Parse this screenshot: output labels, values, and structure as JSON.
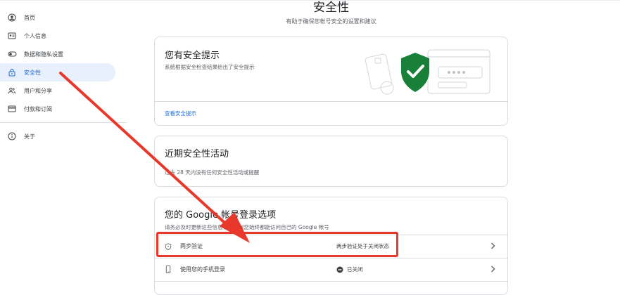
{
  "header": {
    "title": "安全性",
    "subtitle": "有助于确保您帐号安全的设置和建议"
  },
  "sidebar": {
    "items": [
      {
        "label": "首页",
        "icon": "home-icon"
      },
      {
        "label": "个人信息",
        "icon": "id-card-icon"
      },
      {
        "label": "数据和隐私设置",
        "icon": "toggle-icon"
      },
      {
        "label": "安全性",
        "icon": "lock-icon",
        "active": true
      },
      {
        "label": "用户和分享",
        "icon": "people-icon"
      },
      {
        "label": "付款和订阅",
        "icon": "credit-card-icon"
      },
      {
        "label": "关于",
        "icon": "info-icon"
      }
    ]
  },
  "security_tips": {
    "title": "您有安全提示",
    "description": "系统根据安全检查结果给出了安全提示",
    "link": "查看安全提示"
  },
  "recent_activity": {
    "title": "近期安全性活动",
    "description": "过去 28 天内没有任何安全性活动或提醒"
  },
  "signin_options": {
    "title": "您的 Google 帐号登录选项",
    "description": "请务必及时更新这些信息，以确保您始终都能访问自己的 Google 帐号",
    "rows": [
      {
        "label": "两步验证",
        "status": "两步验证处于关闭状态",
        "icon": "shield-icon"
      },
      {
        "label": "使用您的手机登录",
        "status": "已关闭",
        "icon": "phone-icon"
      }
    ]
  },
  "colors": {
    "accent": "#1a73e8",
    "active_bg": "#e8f0fe",
    "annotation": "#e8372b",
    "shield": "#188038"
  }
}
